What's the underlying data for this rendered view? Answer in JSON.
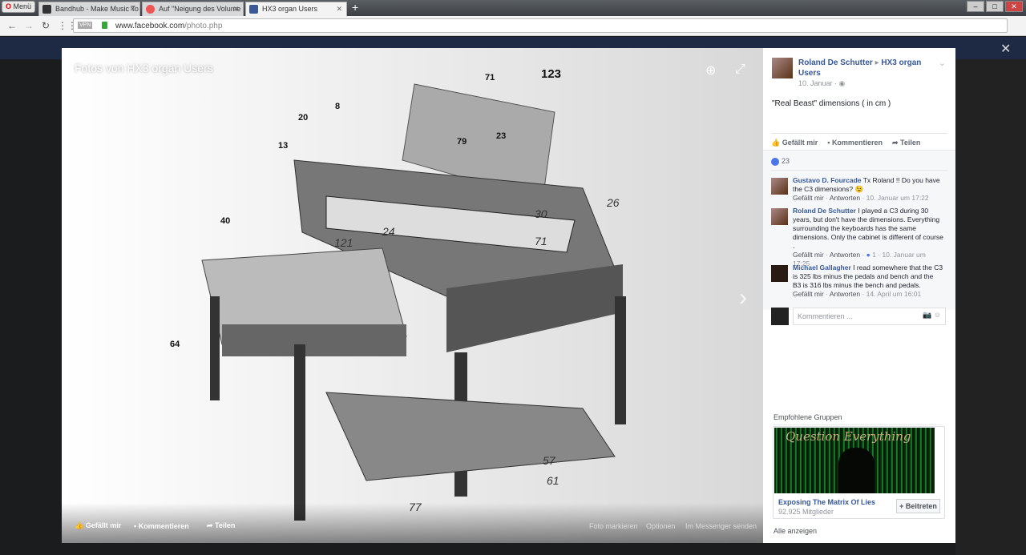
{
  "browser": {
    "menu": "Menü",
    "tabs": [
      {
        "title": "Bandhub - Make Music To"
      },
      {
        "title": "Auf \"Neigung des Volume"
      },
      {
        "title": "HX3 organ Users"
      }
    ],
    "vpn": "VPN",
    "url_domain": "www.facebook.com",
    "url_path": "/photo.php"
  },
  "photo": {
    "title": "Fotos von HX3 organ Users",
    "labels": [
      "71",
      "123",
      "8",
      "20",
      "13",
      "79",
      "23",
      "40",
      "64",
      "26",
      "30",
      "71",
      "121",
      "24",
      "57",
      "61",
      "77"
    ],
    "actions": {
      "like": "Gefällt mir",
      "comment": "Kommentieren",
      "share": "Teilen",
      "tag": "Foto markieren",
      "options": "Optionen",
      "messenger": "Im Messenger senden"
    }
  },
  "post": {
    "author": "Roland De Schutter",
    "arrow": "▸",
    "group": "HX3 organ Users",
    "date": "10. Januar",
    "caption": "\"Real Beast\" dimensions ( in cm )",
    "like": "Gefällt mir",
    "comment": "Kommentieren",
    "share": "Teilen",
    "like_count": "23"
  },
  "comments": [
    {
      "author": "Gustavo D. Fourcade",
      "text": "Tx Roland !! Do you have the C3 dimensions? 😉",
      "like": "Gefällt mir",
      "reply": "Antworten",
      "likes": "",
      "time": "10. Januar um 17:22"
    },
    {
      "author": "Roland De Schutter",
      "text": "I played a C3 during 30 years, but don't have the dimensions. Everything surrounding the keyboards has the same dimensions. Only the cabinet is different of course .",
      "like": "Gefällt mir",
      "reply": "Antworten",
      "likes": "1",
      "time": "10. Januar um 17:25"
    },
    {
      "author": "Michael Gallagher",
      "text": "I read somewhere that the C3 is 325 lbs minus the pedals and bench and the B3 is 316 lbs minus the bench and pedals.",
      "like": "Gefällt mir",
      "reply": "Antworten",
      "likes": "",
      "time": "14. April um 16:01"
    }
  ],
  "comment_placeholder": "Kommentieren ...",
  "recommended": {
    "heading": "Empfohlene Gruppen",
    "image_text": "Question Everything",
    "name": "Exposing The Matrix Of Lies",
    "members": "92.925 Mitglieder",
    "join": "+ Beitreten",
    "show_all": "Alle anzeigen"
  }
}
